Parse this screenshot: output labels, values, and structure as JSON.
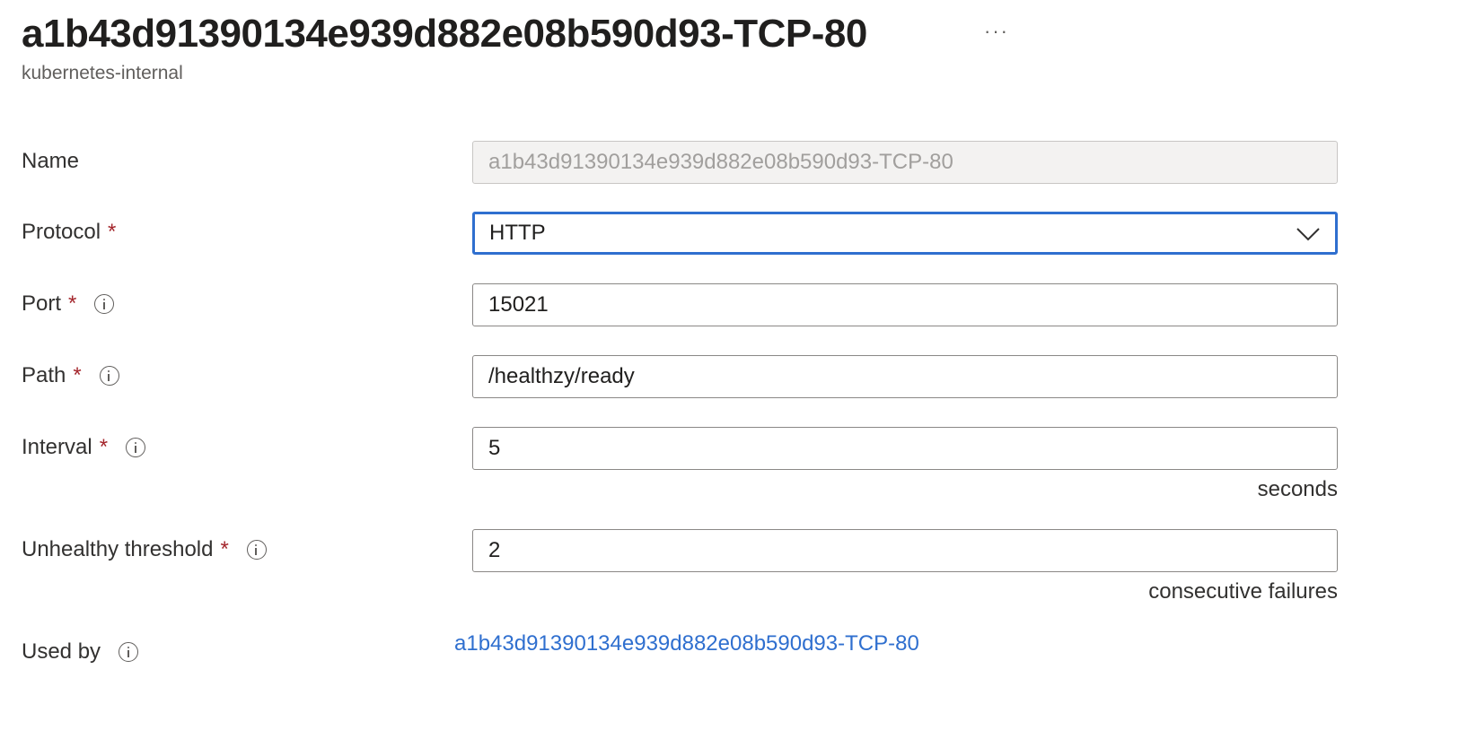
{
  "header": {
    "title": "a1b43d91390134e939d882e08b590d93-TCP-80",
    "subtitle": "kubernetes-internal",
    "more_label": "···"
  },
  "form": {
    "name": {
      "label": "Name",
      "value": "a1b43d91390134e939d882e08b590d93-TCP-80"
    },
    "protocol": {
      "label": "Protocol",
      "required": "*",
      "value": "HTTP"
    },
    "port": {
      "label": "Port",
      "required": "*",
      "value": "15021"
    },
    "path": {
      "label": "Path",
      "required": "*",
      "value": "/healthzy/ready"
    },
    "interval": {
      "label": "Interval",
      "required": "*",
      "value": "5",
      "unit": "seconds"
    },
    "unhealthy_threshold": {
      "label": "Unhealthy threshold",
      "required": "*",
      "value": "2",
      "unit": "consecutive failures"
    },
    "used_by": {
      "label": "Used by",
      "link_text": "a1b43d91390134e939d882e08b590d93-TCP-80"
    }
  },
  "colors": {
    "accent": "#2f6fcf",
    "required": "#a4262c",
    "link": "#2f6fcf"
  },
  "icons": [
    "info-icon",
    "chevron-down-icon",
    "more-icon"
  ]
}
